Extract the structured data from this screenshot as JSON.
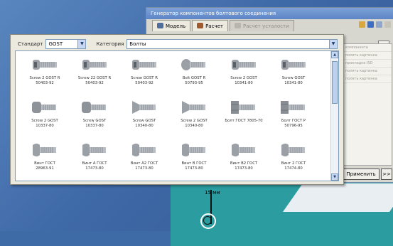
{
  "app": {
    "title": "Генератор компонентов болтового соединения",
    "tabs": [
      {
        "label": "Модель",
        "active": true
      },
      {
        "label": "Расчет",
        "active": false
      },
      {
        "label": "Расчет усталости",
        "active": false,
        "disabled": true
      }
    ],
    "right_panel_items": [
      "компонента",
      "полять картинка",
      "прокладка ISO",
      "полять картинка",
      "полять картинка"
    ],
    "apply_label": "Применить",
    "more_label": ">>",
    "spin_glyph": "▲▼"
  },
  "dialog": {
    "standard_label": "Стандарт",
    "standard_value": "GOST",
    "category_label": "Категория",
    "category_value": "Болты",
    "items": [
      {
        "label": "Screw 2 GOST R\n50403-92",
        "icon": "screw-hex-socket-icon"
      },
      {
        "label": "Screw 22 GOST R\n50403-92",
        "icon": "screw-hex-socket-icon"
      },
      {
        "label": "Screw GOST R\n50403-92",
        "icon": "screw-hex-socket-icon"
      },
      {
        "label": "Bolt GOST R\n50793-95",
        "icon": "bolt-pan-head-icon"
      },
      {
        "label": "Screw 2 GOST\n10341-80",
        "icon": "screw-hex-socket-icon"
      },
      {
        "label": "Screw GOST\n10341-80",
        "icon": "screw-hex-socket-icon"
      },
      {
        "label": "Screw 2 GOST\n10337-80",
        "icon": "screw-cap-head-icon"
      },
      {
        "label": "Screw GOST\n10337-80",
        "icon": "screw-cap-head-icon"
      },
      {
        "label": "Screw GOST\n10340-80",
        "icon": "screw-countersunk-icon"
      },
      {
        "label": "Screw 2 GOST\n10340-80",
        "icon": "screw-countersunk-icon"
      },
      {
        "label": "Болт ГОСТ 7805-70",
        "icon": "bolt-hex-head-icon"
      },
      {
        "label": "Болт ГОСТ Р\n50796-95",
        "icon": "bolt-hex-head-icon"
      },
      {
        "label": "Винт ГОСТ\n28963-91",
        "icon": "screw-pan-head-icon"
      },
      {
        "label": "Винт А ГОСТ\n17473-80",
        "icon": "screw-pan-head-icon"
      },
      {
        "label": "Винт А2 ГОСТ\n17473-80",
        "icon": "screw-pan-head-icon"
      },
      {
        "label": "Винт В ГОСТ\n17473-80",
        "icon": "screw-pan-head-icon"
      },
      {
        "label": "Винт В2 ГОСТ\n17473-80",
        "icon": "screw-pan-head-icon"
      },
      {
        "label": "Винт 2 ГОСТ\n17474-80",
        "icon": "screw-pan-head-icon"
      }
    ]
  },
  "canvas": {
    "dimension_label": "15 мм"
  },
  "colors": {
    "desktop": "#3f6aa8",
    "cad_fill": "#2b9c9f",
    "dialog_bg": "#ece9df"
  }
}
